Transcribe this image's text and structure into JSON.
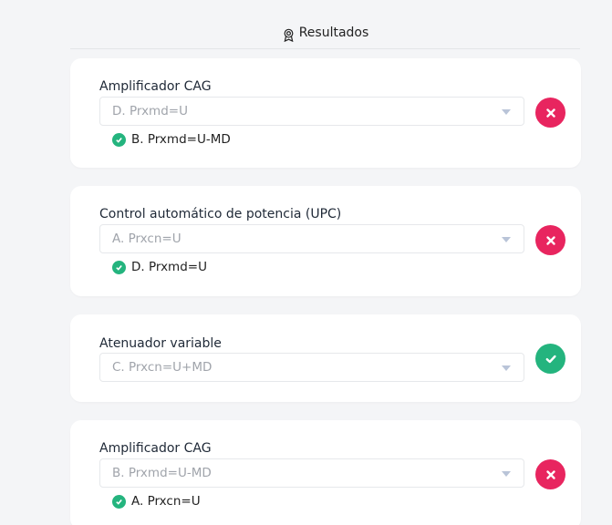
{
  "header": {
    "title": "Resultados",
    "icon": "award-icon"
  },
  "colors": {
    "wrong": "#e8255f",
    "correct": "#24b47e"
  },
  "items": [
    {
      "question": "Amplificador CAG",
      "selected": "D. Prxmd=U",
      "correct": false,
      "correct_answer": "B. Prxmd=U-MD"
    },
    {
      "question": "Control automático de potencia (UPC)",
      "selected": "A. Prxcn=U",
      "correct": false,
      "correct_answer": "D. Prxmd=U"
    },
    {
      "question": "Atenuador variable",
      "selected": "C. Prxcn=U+MD",
      "correct": true
    },
    {
      "question": "Amplificador CAG",
      "selected": "B. Prxmd=U-MD",
      "correct": false,
      "correct_answer": "A. Prxcn=U"
    }
  ]
}
